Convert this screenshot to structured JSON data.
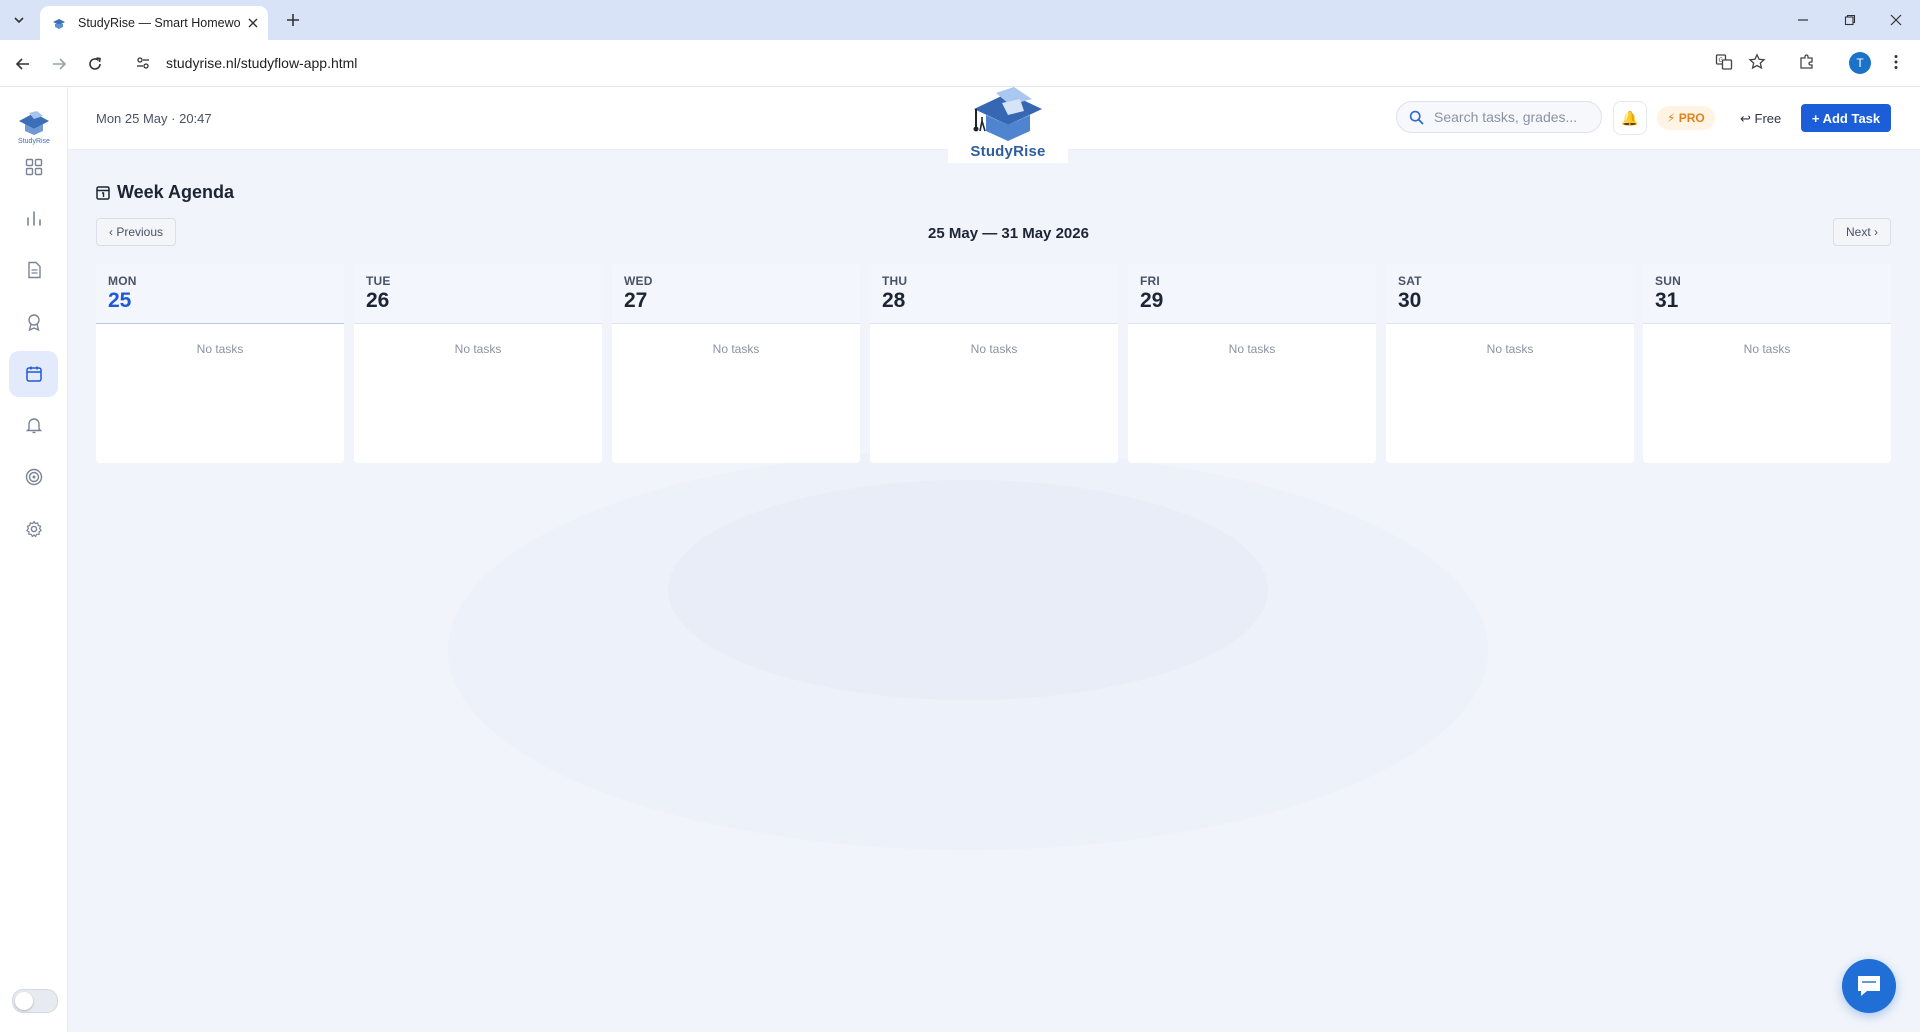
{
  "browser": {
    "tab_title": "StudyRise — Smart Homework",
    "url": "studyrise.nl/studyflow-app.html",
    "profile_initial": "T"
  },
  "sidebar": {
    "logo_text": "StudyRise",
    "items": [
      {
        "name": "dashboard",
        "icon": "grid-icon",
        "active": false
      },
      {
        "name": "analytics",
        "icon": "bar-chart-icon",
        "active": false
      },
      {
        "name": "documents",
        "icon": "document-icon",
        "active": false
      },
      {
        "name": "achievements",
        "icon": "award-icon",
        "active": false
      },
      {
        "name": "calendar",
        "icon": "calendar-icon",
        "active": true
      },
      {
        "name": "notifications",
        "icon": "bell-icon",
        "active": false
      },
      {
        "name": "goals",
        "icon": "target-icon",
        "active": false
      },
      {
        "name": "settings",
        "icon": "gear-icon",
        "active": false
      }
    ]
  },
  "header": {
    "datetime": "Mon 25 May · 20:47",
    "brand_name": "StudyRise",
    "search_placeholder": "Search tasks, grades...",
    "bell_glyph": "🔔",
    "pro_label": "⚡ PRO",
    "free_label": "↩ Free",
    "add_task_label": "+ Add Task"
  },
  "agenda": {
    "title": "Week Agenda",
    "prev_label": "‹ Previous",
    "next_label": "Next ›",
    "range": "25 May — 31 May 2026",
    "days": [
      {
        "name": "MON",
        "num": "25",
        "today": true,
        "empty_text": "No tasks"
      },
      {
        "name": "TUE",
        "num": "26",
        "today": false,
        "empty_text": "No tasks"
      },
      {
        "name": "WED",
        "num": "27",
        "today": false,
        "empty_text": "No tasks"
      },
      {
        "name": "THU",
        "num": "28",
        "today": false,
        "empty_text": "No tasks"
      },
      {
        "name": "FRI",
        "num": "29",
        "today": false,
        "empty_text": "No tasks"
      },
      {
        "name": "SAT",
        "num": "30",
        "today": false,
        "empty_text": "No tasks"
      },
      {
        "name": "SUN",
        "num": "31",
        "today": false,
        "empty_text": "No tasks"
      }
    ]
  },
  "colors": {
    "accent": "#1b5ed8",
    "today_number": "#1f59d4",
    "pro": "#e0821d",
    "sidebar_active": "#e3eafb"
  }
}
